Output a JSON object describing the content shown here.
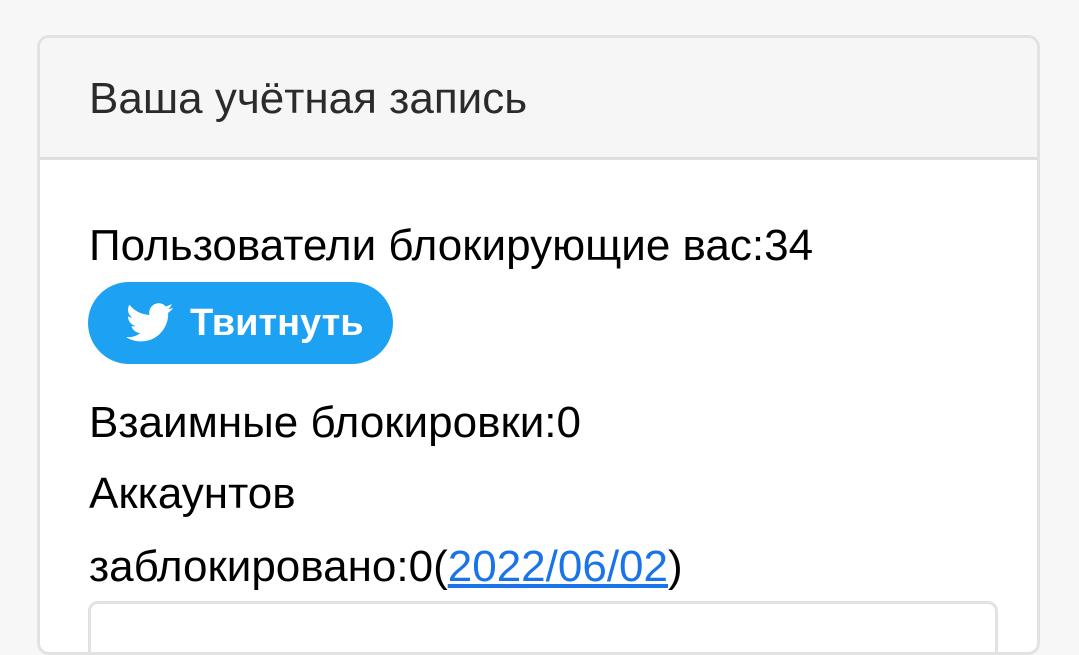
{
  "card": {
    "title": "Ваша учётная запись",
    "blockers_label": "Пользователи блокирующие вас:",
    "blockers_count": "34",
    "tweet_button_label": "Твитнуть",
    "mutual_label": "Взаимные блокировки:",
    "mutual_count": "0",
    "accounts_label": "Аккаунтов",
    "blocked_label": "заблокировано:",
    "blocked_count": "0",
    "open_paren": "(",
    "blocked_date": "2022/06/02",
    "close_paren": ")"
  },
  "colors": {
    "accent": "#1da1f2",
    "link": "#1a73e8"
  },
  "icons": {
    "tweet_button_icon": "twitter-bird-icon"
  }
}
